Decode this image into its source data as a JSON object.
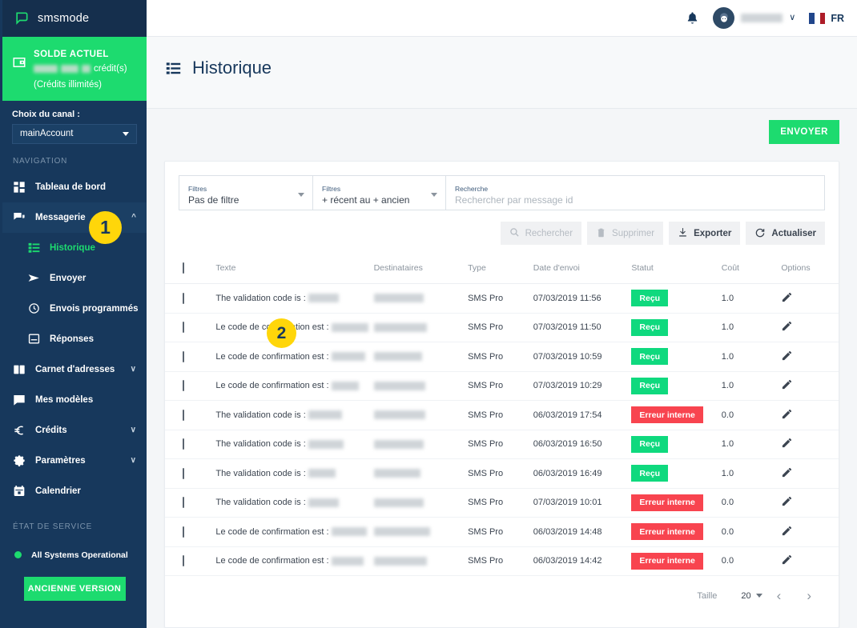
{
  "sidebar": {
    "brand": {
      "name": "smsmode",
      "logo_icon": "speech-bubble-logo"
    },
    "balance": {
      "title": "SOLDE ACTUEL",
      "credits_suffix": "crédit(s)",
      "unlimited": "(Crédits illimités)",
      "icon": "wallet-icon",
      "bg_color": "#1ddb6f"
    },
    "channel": {
      "label": "Choix du canal :",
      "value": "mainAccount"
    },
    "nav_header": "NAVIGATION",
    "items": [
      {
        "label": "Tableau de bord",
        "icon": "dashboard-grid-icon",
        "expandable": false
      },
      {
        "label": "Messagerie",
        "icon": "chat-bubbles-icon",
        "expandable": true,
        "expanded": true
      }
    ],
    "messagerie_children": [
      {
        "label": "Historique",
        "icon": "list-icon",
        "selected": true
      },
      {
        "label": "Envoyer",
        "icon": "paper-plane-icon",
        "selected": false
      },
      {
        "label": "Envois programmés",
        "icon": "clock-icon",
        "selected": false
      },
      {
        "label": "Réponses",
        "icon": "inbox-icon",
        "selected": false
      }
    ],
    "items_bottom": [
      {
        "label": "Carnet d'adresses",
        "icon": "address-book-icon",
        "expandable": true
      },
      {
        "label": "Mes modèles",
        "icon": "template-icon",
        "expandable": false
      },
      {
        "label": "Crédits",
        "icon": "euro-icon",
        "expandable": true
      },
      {
        "label": "Paramètres",
        "icon": "gear-icon",
        "expandable": true
      },
      {
        "label": "Calendrier",
        "icon": "calendar-icon",
        "expandable": false
      }
    ],
    "service_header": "ÉTAT DE SERVICE",
    "service_status": "All Systems Operational",
    "old_version_button": "ANCIENNE VERSION"
  },
  "topbar": {
    "bell_icon": "bell-icon",
    "avatar_icon": "user-avatar-icon",
    "chevron_icon": "chevron-down-icon",
    "language": "FR",
    "flag_icon": "france-flag-icon"
  },
  "page": {
    "title": "Historique",
    "title_icon": "list-view-icon"
  },
  "send_button": "ENVOYER",
  "filters": {
    "filter1": {
      "label": "Filtres",
      "value": "Pas de filtre"
    },
    "filter2": {
      "label": "Filtres",
      "value": "+ récent au + ancien"
    },
    "search": {
      "label": "Recherche",
      "placeholder": "Rechercher par message id",
      "value": ""
    }
  },
  "actions": [
    {
      "label": "Rechercher",
      "icon": "search-icon",
      "enabled": false
    },
    {
      "label": "Supprimer",
      "icon": "trash-icon",
      "enabled": false
    },
    {
      "label": "Exporter",
      "icon": "download-icon",
      "enabled": true
    },
    {
      "label": "Actualiser",
      "icon": "refresh-icon",
      "enabled": true
    }
  ],
  "table": {
    "columns": [
      "",
      "Texte",
      "Destinataires",
      "Type",
      "Date d'envoi",
      "Statut",
      "Coût",
      "Options"
    ],
    "rows": [
      {
        "texte": "The validation code is :",
        "destinataires": "",
        "type": "SMS Pro",
        "date": "07/03/2019 11:56",
        "statut": "Reçu",
        "statut_kind": "ok",
        "cout": "1.0",
        "options_icon": "pencil-icon"
      },
      {
        "texte": "Le code de confirmation est :",
        "destinataires": "",
        "type": "SMS Pro",
        "date": "07/03/2019 11:50",
        "statut": "Reçu",
        "statut_kind": "ok",
        "cout": "1.0",
        "options_icon": "pencil-icon"
      },
      {
        "texte": "Le code de confirmation est :",
        "destinataires": "",
        "type": "SMS Pro",
        "date": "07/03/2019 10:59",
        "statut": "Reçu",
        "statut_kind": "ok",
        "cout": "1.0",
        "options_icon": "pencil-icon"
      },
      {
        "texte": "Le code de confirmation est :",
        "destinataires": "",
        "type": "SMS Pro",
        "date": "07/03/2019 10:29",
        "statut": "Reçu",
        "statut_kind": "ok",
        "cout": "1.0",
        "options_icon": "pencil-icon"
      },
      {
        "texte": "The validation code is :",
        "destinataires": "",
        "type": "SMS Pro",
        "date": "06/03/2019 17:54",
        "statut": "Erreur interne",
        "statut_kind": "err",
        "cout": "0.0",
        "options_icon": "pencil-icon"
      },
      {
        "texte": "The validation code is :",
        "destinataires": "",
        "type": "SMS Pro",
        "date": "06/03/2019 16:50",
        "statut": "Reçu",
        "statut_kind": "ok",
        "cout": "1.0",
        "options_icon": "pencil-icon"
      },
      {
        "texte": "The validation code is :",
        "destinataires": "",
        "type": "SMS Pro",
        "date": "06/03/2019 16:49",
        "statut": "Reçu",
        "statut_kind": "ok",
        "cout": "1.0",
        "options_icon": "pencil-icon"
      },
      {
        "texte": "The validation code is :",
        "destinataires": "",
        "type": "SMS Pro",
        "date": "07/03/2019 10:01",
        "statut": "Erreur interne",
        "statut_kind": "err",
        "cout": "0.0",
        "options_icon": "pencil-icon"
      },
      {
        "texte": "Le code de confirmation est :",
        "destinataires": "",
        "type": "SMS Pro",
        "date": "06/03/2019 14:48",
        "statut": "Erreur interne",
        "statut_kind": "err",
        "cout": "0.0",
        "options_icon": "pencil-icon"
      },
      {
        "texte": "Le code de confirmation est :",
        "destinataires": "",
        "type": "SMS Pro",
        "date": "06/03/2019 14:42",
        "statut": "Erreur interne",
        "statut_kind": "err",
        "cout": "0.0",
        "options_icon": "pencil-icon"
      }
    ]
  },
  "pagination": {
    "size_label": "Taille",
    "size_value": "20",
    "prev_icon": "chevron-left-icon",
    "next_icon": "chevron-right-icon"
  },
  "annotations": [
    {
      "number": "1"
    },
    {
      "number": "2"
    }
  ],
  "colors": {
    "sidebar_bg": "#17385c",
    "accent_green": "#1ddb6f",
    "status_ok": "#0fd97e",
    "status_error": "#f8444f",
    "marker": "#ffd60a"
  }
}
